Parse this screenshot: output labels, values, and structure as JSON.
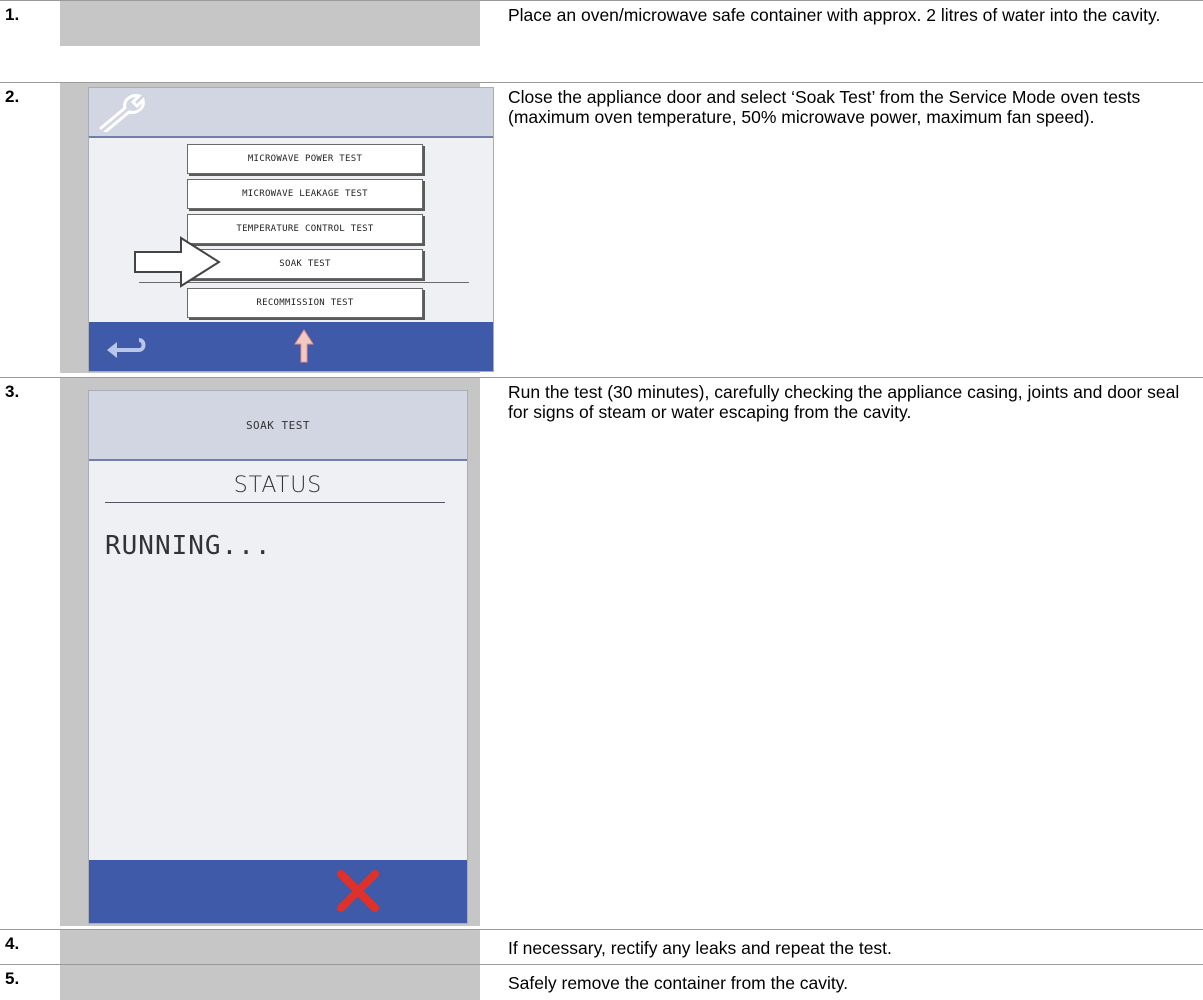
{
  "steps": [
    {
      "number": "1.",
      "text": "Place an oven/microwave safe container with approx. 2 litres of water into the cavity."
    },
    {
      "number": "2.",
      "text": "Close the appliance door and select ‘Soak Test’ from the Service Mode oven tests (maximum oven temperature, 50% microwave power, maximum fan speed)."
    },
    {
      "number": "3.",
      "text": "Run the test (30 minutes), carefully checking the appliance casing, joints and door seal for signs of steam or water escaping from the cavity."
    },
    {
      "number": "4.",
      "text": "If necessary, rectify any leaks and repeat the test."
    },
    {
      "number": "5.",
      "text": "Safely remove the container from the cavity."
    }
  ],
  "service_menu": {
    "icon": "wrench-icon",
    "items": [
      "MICROWAVE POWER TEST",
      "MICROWAVE LEAKAGE TEST",
      "TEMPERATURE CONTROL TEST",
      "SOAK TEST",
      "RECOMMISSION TEST"
    ],
    "selected": "SOAK TEST",
    "footer_icons": [
      "back-arrow-icon",
      "up-arrow-icon"
    ]
  },
  "soak_screen": {
    "title": "SOAK TEST",
    "status_heading": "STATUS",
    "status_value": "RUNNING...",
    "footer_icon": "cancel-x-icon"
  },
  "colors": {
    "cell_gray": "#c6c6c6",
    "screen_bg": "#eef0f4",
    "footer_blue": "#3f5aa8",
    "cancel_red": "#e0302a"
  }
}
